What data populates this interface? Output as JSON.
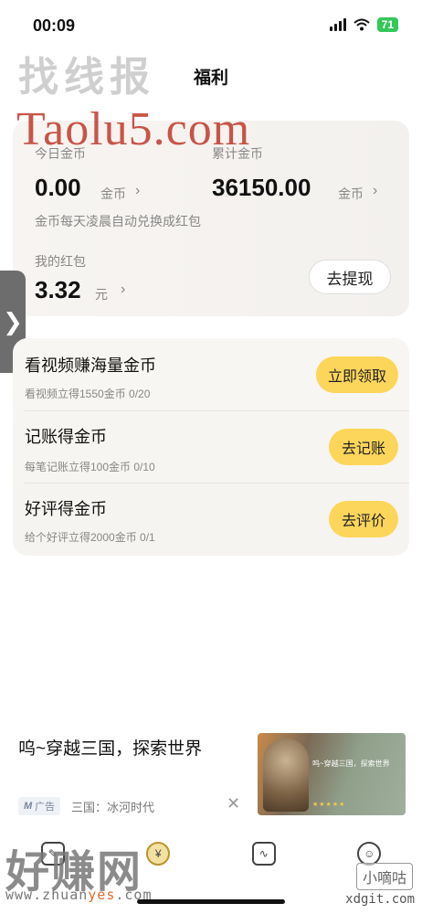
{
  "status_bar": {
    "time": "00:09",
    "battery": "71"
  },
  "watermarks": {
    "top_brand": "找线报",
    "top_url": "Taolu5.com",
    "bottom_brand": "好赚网",
    "bottom_url_prefix": "www.zhuan",
    "bottom_url_highlight": "yes",
    "bottom_url_suffix": ".com",
    "right_brand": "小嘀咕",
    "right_url": "xdgit.com"
  },
  "header": {
    "title": "福利"
  },
  "coins": {
    "today_label": "今日金币",
    "today_value": "0.00",
    "today_unit": "金币",
    "total_label": "累计金币",
    "total_value": "36150.00",
    "total_unit": "金币",
    "note": "金币每天凌晨自动兑换成红包",
    "redpacket_label": "我的红包",
    "redpacket_value": "3.32",
    "redpacket_unit": "元",
    "withdraw_label": "去提现"
  },
  "side_tab": {
    "glyph": "❯"
  },
  "tasks": [
    {
      "title": "看视频赚海量金币",
      "subtitle": "看视频立得1550金币 0/20",
      "button": "立即领取"
    },
    {
      "title": "记账得金币",
      "subtitle": "每笔记账立得100金币 0/10",
      "button": "去记账"
    },
    {
      "title": "好评得金币",
      "subtitle": "给个好评立得2000金币 0/1",
      "button": "去评价"
    }
  ],
  "ad": {
    "title": "呜~穿越三国，探索世界",
    "tag": "广告",
    "source": "三国：冰河时代",
    "close": "✕",
    "image_caption": "呜~穿越三国，探索世界",
    "image_stars": "★★★★★"
  },
  "bottom_nav": {
    "items": [
      {
        "icon": "ledger-icon"
      },
      {
        "icon": "coin-icon"
      },
      {
        "icon": "chart-icon"
      },
      {
        "icon": "profile-icon"
      }
    ]
  },
  "colors": {
    "accent": "#fcd65a",
    "card_bg": "#f6f4f1",
    "muted_text": "#888888"
  }
}
